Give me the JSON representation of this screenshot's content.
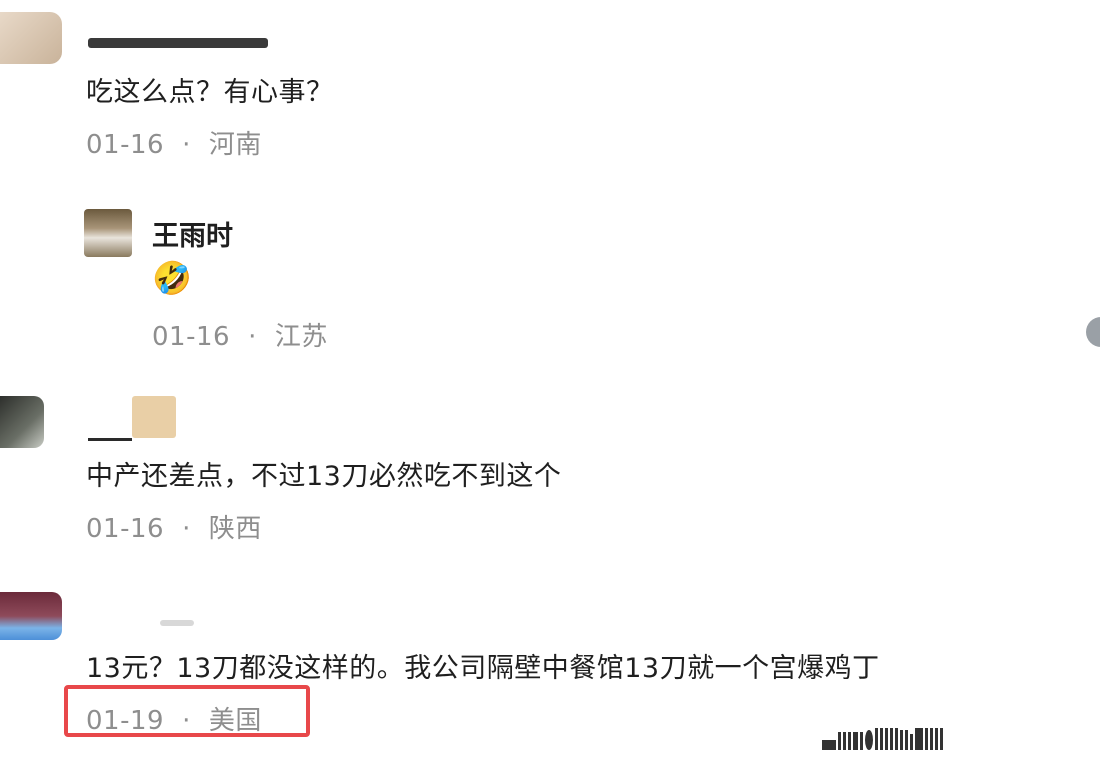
{
  "comments": [
    {
      "id": "c1",
      "text": "吃这么点？有心事？",
      "date": "01-16",
      "separator": "·",
      "location": "河南"
    },
    {
      "id": "reply1",
      "author": "王雨时",
      "emoji": "🤣",
      "date": "01-16",
      "separator": "·",
      "location": "江苏"
    },
    {
      "id": "c2",
      "text": "中产还差点，不过13刀必然吃不到这个",
      "date": "01-16",
      "separator": "·",
      "location": "陕西"
    },
    {
      "id": "c3",
      "text": "13元？13刀都没这样的。我公司隔壁中餐馆13刀就一个宫爆鸡丁",
      "date": "01-19",
      "separator": "·",
      "location": "美国"
    }
  ],
  "colors": {
    "highlight": "#e8484a",
    "meta_text": "#8e8e8e",
    "body_text": "#1f1f1f"
  }
}
